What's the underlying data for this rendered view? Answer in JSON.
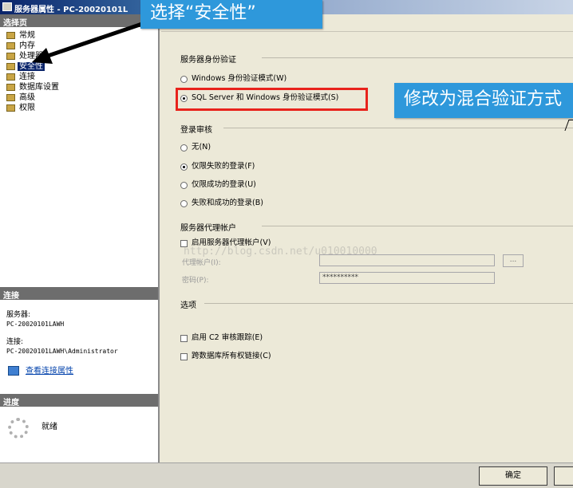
{
  "window": {
    "title": "服务器属性 - PC-20020101L"
  },
  "sidebar": {
    "header": "选择页",
    "items": [
      {
        "label": "常规",
        "selected": false
      },
      {
        "label": "内存",
        "selected": false
      },
      {
        "label": "处理器",
        "selected": false
      },
      {
        "label": "安全性",
        "selected": true
      },
      {
        "label": "连接",
        "selected": false
      },
      {
        "label": "数据库设置",
        "selected": false
      },
      {
        "label": "高级",
        "selected": false
      },
      {
        "label": "权限",
        "selected": false
      }
    ]
  },
  "connection": {
    "header": "连接",
    "server_label": "服务器:",
    "server_value": "PC-20020101LAWH",
    "conn_label": "连接:",
    "conn_value": "PC-20020101LAWH\\Administrator",
    "link": "查看连接属性"
  },
  "progress": {
    "header": "进度",
    "status": "就绪"
  },
  "security": {
    "auth_group": "服务器身份验证",
    "auth_options": [
      {
        "label": "Windows 身份验证模式(W)",
        "checked": false
      },
      {
        "label": "SQL Server 和 Windows 身份验证模式(S)",
        "checked": true
      }
    ],
    "audit_group": "登录审核",
    "audit_options": [
      {
        "label": "无(N)",
        "checked": false
      },
      {
        "label": "仅限失败的登录(F)",
        "checked": true
      },
      {
        "label": "仅限成功的登录(U)",
        "checked": false
      },
      {
        "label": "失败和成功的登录(B)",
        "checked": false
      }
    ],
    "proxy_group": "服务器代理帐户",
    "proxy_enable": "启用服务器代理帐户(V)",
    "proxy_account_label": "代理帐户(I):",
    "password_label": "密码(P):",
    "password_value": "**********",
    "browse_button": "...",
    "options_group": "选项",
    "c2_audit": "启用 C2 审核跟踪(E)",
    "cross_db": "跨数据库所有权链接(C)"
  },
  "buttons": {
    "ok": "确定"
  },
  "annotations": {
    "callout_security": "选择“安全性”",
    "callout_mixed": "修改为混合验证方式"
  },
  "watermark": "http://blog.csdn.net/u010010000",
  "colors": {
    "callout": "#2e98db",
    "highlight_box": "#e8231c",
    "selection": "#0a246a"
  }
}
